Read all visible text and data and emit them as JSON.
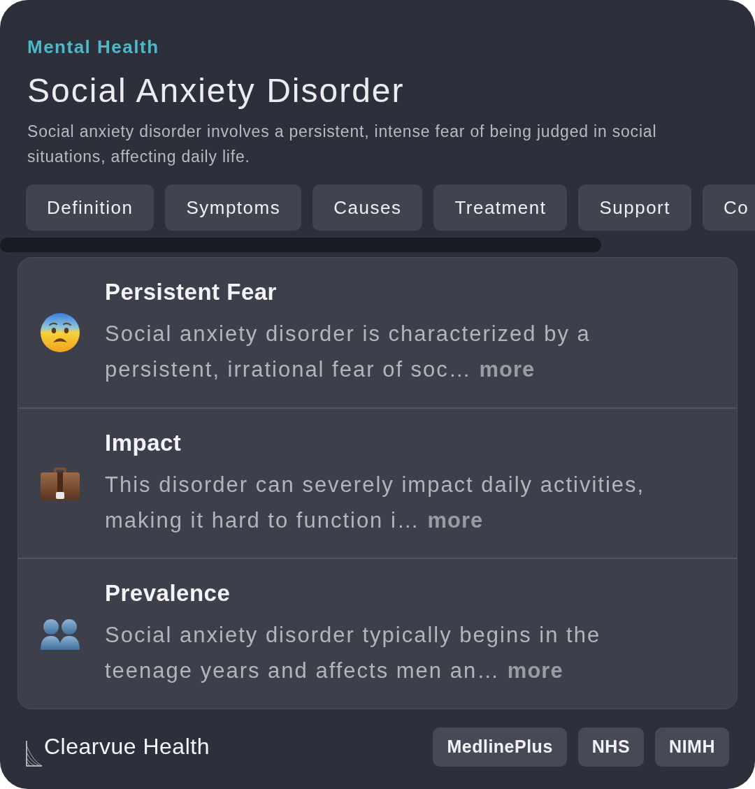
{
  "category": "Mental Health",
  "title": "Social Anxiety Disorder",
  "description": "Social anxiety disorder involves a persistent, intense fear of being judged in social situations, affecting daily life.",
  "tabs": [
    "Definition",
    "Symptoms",
    "Causes",
    "Treatment",
    "Support",
    "Co"
  ],
  "items": [
    {
      "kind": "face",
      "title": "Persistent Fear",
      "body": "Social anxiety disorder is characterized by a persistent, irrational fear of soc…",
      "more": "more"
    },
    {
      "kind": "briefcase",
      "title": "Impact",
      "body": "This disorder can severely impact daily activities, making it hard to function i…",
      "more": "more"
    },
    {
      "kind": "people",
      "title": "Prevalence",
      "body": "Social anxiety disorder typically begins in the teenage years and affects men an…",
      "more": "more"
    }
  ],
  "footer": {
    "brand": "Clearvue Health",
    "sources": [
      "MedlinePlus",
      "NHS",
      "NIMH"
    ]
  }
}
